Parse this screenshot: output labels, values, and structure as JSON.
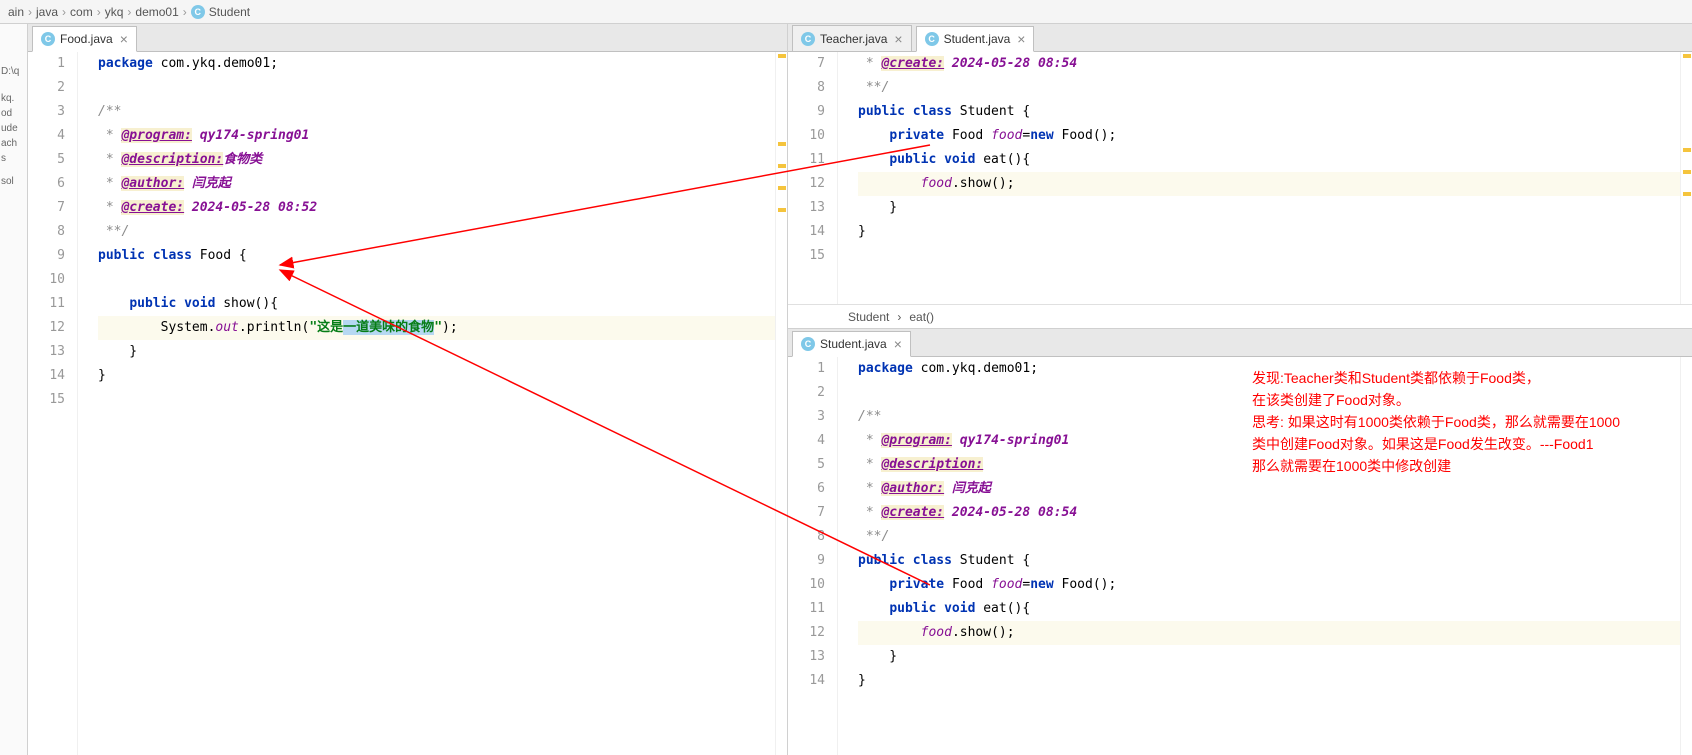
{
  "breadcrumb": {
    "parts": [
      "ain",
      "java",
      "com",
      "ykq",
      "demo01",
      "Student"
    ]
  },
  "leftStrip": {
    "items": [
      "D:\\q",
      "",
      "",
      "",
      "kq.",
      "od",
      "ude",
      "ach",
      "s",
      "",
      "",
      "sol"
    ]
  },
  "leftPane": {
    "tabs": [
      {
        "label": "Food.java",
        "active": true
      }
    ],
    "gutterStart": 1,
    "lines": [
      {
        "tokens": [
          [
            "kw",
            "package "
          ],
          [
            "pkg",
            "com.ykq.demo01;"
          ]
        ]
      },
      {
        "tokens": []
      },
      {
        "tokens": [
          [
            "doc",
            "/**"
          ]
        ]
      },
      {
        "tokens": [
          [
            "doc",
            " * "
          ],
          [
            "tag",
            "@program:"
          ],
          [
            "tagtxt",
            " qy174-spring01"
          ]
        ]
      },
      {
        "tokens": [
          [
            "doc",
            " * "
          ],
          [
            "tag",
            "@description:"
          ],
          [
            "tagtxt",
            "食物类"
          ]
        ]
      },
      {
        "tokens": [
          [
            "doc",
            " * "
          ],
          [
            "tag",
            "@author:"
          ],
          [
            "tagtxt",
            " 闫克起"
          ]
        ]
      },
      {
        "tokens": [
          [
            "doc",
            " * "
          ],
          [
            "tag",
            "@create:"
          ],
          [
            "tagtxt",
            " 2024-05-28 08:52"
          ]
        ]
      },
      {
        "tokens": [
          [
            "doc",
            " **/"
          ]
        ]
      },
      {
        "tokens": [
          [
            "kw",
            "public class "
          ],
          [
            "cls",
            "Food "
          ],
          [
            "ident",
            "{"
          ]
        ]
      },
      {
        "tokens": []
      },
      {
        "tokens": [
          [
            "ident",
            "    "
          ],
          [
            "kw",
            "public void "
          ],
          [
            "mth",
            "show"
          ],
          [
            "ident",
            "(){"
          ]
        ]
      },
      {
        "hl": true,
        "tokens": [
          [
            "ident",
            "        System."
          ],
          [
            "static",
            "out"
          ],
          [
            "ident",
            ".println("
          ],
          [
            "str",
            "\"这是"
          ],
          [
            "hl-sel",
            "一道美味的食物"
          ],
          [
            "str",
            "\""
          ],
          [
            "ident",
            ");"
          ]
        ]
      },
      {
        "tokens": [
          [
            "ident",
            "    }"
          ]
        ]
      },
      {
        "tokens": [
          [
            "ident",
            "}"
          ]
        ]
      },
      {
        "tokens": []
      }
    ]
  },
  "rightTop": {
    "tabs": [
      {
        "label": "Teacher.java",
        "active": false
      },
      {
        "label": "Student.java",
        "active": true
      }
    ],
    "gutterStart": 7,
    "lines": [
      {
        "tokens": [
          [
            "doc",
            " * "
          ],
          [
            "tag",
            "@create:"
          ],
          [
            "tagtxt",
            " 2024-05-28 08:54"
          ]
        ]
      },
      {
        "tokens": [
          [
            "doc",
            " **/"
          ]
        ]
      },
      {
        "tokens": [
          [
            "kw",
            "public class "
          ],
          [
            "cls",
            "Student "
          ],
          [
            "ident",
            "{"
          ]
        ]
      },
      {
        "tokens": [
          [
            "ident",
            "    "
          ],
          [
            "kw",
            "private "
          ],
          [
            "cls",
            "Food "
          ],
          [
            "field",
            "food"
          ],
          [
            "ident",
            "="
          ],
          [
            "kw",
            "new "
          ],
          [
            "cls",
            "Food"
          ],
          [
            "ident",
            "();"
          ]
        ]
      },
      {
        "tokens": [
          [
            "ident",
            "    "
          ],
          [
            "kw",
            "public void "
          ],
          [
            "mth",
            "eat"
          ],
          [
            "ident",
            "(){"
          ]
        ]
      },
      {
        "hl": true,
        "tokens": [
          [
            "ident",
            "        "
          ],
          [
            "field",
            "food"
          ],
          [
            "ident",
            ".show();"
          ]
        ]
      },
      {
        "tokens": [
          [
            "ident",
            "    }"
          ]
        ]
      },
      {
        "tokens": [
          [
            "ident",
            "}"
          ]
        ]
      },
      {
        "tokens": []
      }
    ],
    "status": {
      "class": "Student",
      "method": "eat()"
    }
  },
  "rightBottom": {
    "tabs": [
      {
        "label": "Student.java",
        "active": true
      }
    ],
    "gutterStart": 1,
    "lines": [
      {
        "tokens": [
          [
            "kw",
            "package "
          ],
          [
            "pkg",
            "com.ykq.demo01;"
          ]
        ]
      },
      {
        "tokens": []
      },
      {
        "tokens": [
          [
            "doc",
            "/**"
          ]
        ]
      },
      {
        "tokens": [
          [
            "doc",
            " * "
          ],
          [
            "tag",
            "@program:"
          ],
          [
            "tagtxt",
            " qy174-spring01"
          ]
        ]
      },
      {
        "tokens": [
          [
            "doc",
            " * "
          ],
          [
            "tag",
            "@description:"
          ]
        ]
      },
      {
        "tokens": [
          [
            "doc",
            " * "
          ],
          [
            "tag",
            "@author:"
          ],
          [
            "tagtxt",
            " 闫克起"
          ]
        ]
      },
      {
        "tokens": [
          [
            "doc",
            " * "
          ],
          [
            "tag",
            "@create:"
          ],
          [
            "tagtxt",
            " 2024-05-28 08:54"
          ]
        ]
      },
      {
        "tokens": [
          [
            "doc",
            " **/"
          ]
        ]
      },
      {
        "tokens": [
          [
            "kw",
            "public class "
          ],
          [
            "cls",
            "Student "
          ],
          [
            "ident",
            "{"
          ]
        ]
      },
      {
        "tokens": [
          [
            "ident",
            "    "
          ],
          [
            "kw",
            "private "
          ],
          [
            "cls",
            "Food "
          ],
          [
            "field",
            "food"
          ],
          [
            "ident",
            "="
          ],
          [
            "kw",
            "new "
          ],
          [
            "cls",
            "Food"
          ],
          [
            "ident",
            "();"
          ]
        ]
      },
      {
        "tokens": [
          [
            "ident",
            "    "
          ],
          [
            "kw",
            "public void "
          ],
          [
            "mth",
            "eat"
          ],
          [
            "ident",
            "(){"
          ]
        ]
      },
      {
        "hl": true,
        "tokens": [
          [
            "ident",
            "        "
          ],
          [
            "field",
            "food"
          ],
          [
            "ident",
            ".show();"
          ]
        ]
      },
      {
        "tokens": [
          [
            "ident",
            "    }"
          ]
        ]
      },
      {
        "tokens": [
          [
            "ident",
            "}"
          ]
        ]
      }
    ]
  },
  "annotation": {
    "lines": [
      "发现:Teacher类和Student类都依赖于Food类，",
      "在该类创建了Food对象。",
      "思考: 如果这时有1000类依赖于Food类，那么就需要在1000",
      "类中创建Food对象。如果这是Food发生改变。---Food1",
      "那么就需要在1000类中修改创建"
    ]
  }
}
